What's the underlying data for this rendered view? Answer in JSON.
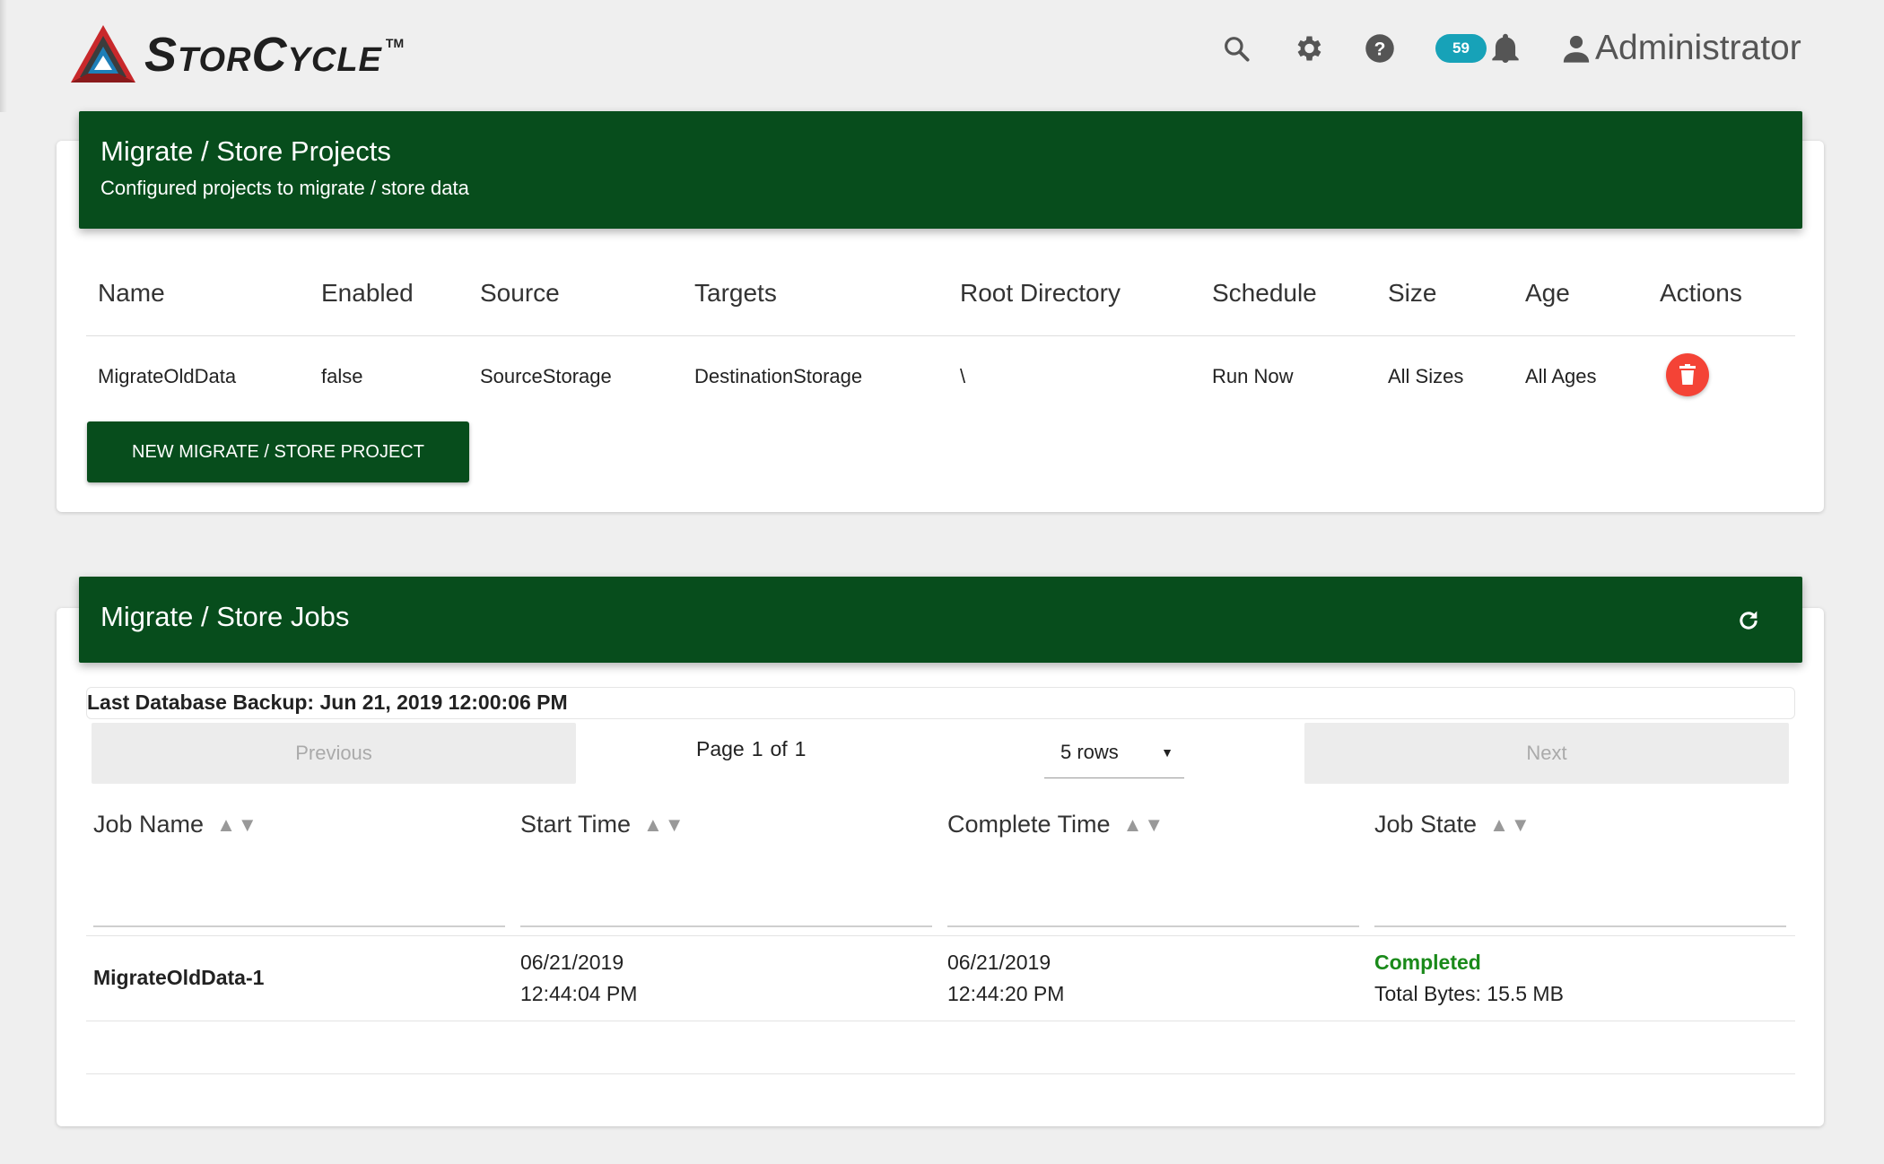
{
  "app": {
    "logo_text": "StorCycle",
    "logo_tm": "TM",
    "notification_count": "59",
    "user_name": "Administrator",
    "icons": [
      "search-icon",
      "gear-icon",
      "help-icon",
      "bell-icon",
      "user-icon"
    ]
  },
  "colors": {
    "header_green": "#074d1c",
    "delete_red": "#f44336",
    "badge_teal": "#17a2b8",
    "completed_green": "#1a8a1a"
  },
  "projects": {
    "title": "Migrate / Store Projects",
    "subtitle": "Configured projects to migrate / store data",
    "columns": [
      "Name",
      "Enabled",
      "Source",
      "Targets",
      "Root Directory",
      "Schedule",
      "Size",
      "Age",
      "Actions"
    ],
    "rows": [
      {
        "name": "MigrateOldData",
        "enabled": "false",
        "source": "SourceStorage",
        "targets": "DestinationStorage",
        "root_directory": "\\",
        "schedule": "Run Now",
        "size": "All Sizes",
        "age": "All Ages"
      }
    ],
    "new_button": "NEW MIGRATE / STORE PROJECT"
  },
  "jobs": {
    "title": "Migrate / Store Jobs",
    "last_backup": "Last Database Backup: Jun 21, 2019 12:00:06 PM",
    "pager": {
      "previous": "Previous",
      "next": "Next",
      "page_label": "Page",
      "page": "1",
      "of_label": "of",
      "total_pages": "1",
      "rows_selected": "5 rows"
    },
    "columns": [
      "Job Name",
      "Start Time",
      "Complete Time",
      "Job State"
    ],
    "rows": [
      {
        "job_name": "MigrateOldData-1",
        "start_date": "06/21/2019",
        "start_time": "12:44:04 PM",
        "complete_date": "06/21/2019",
        "complete_time": "12:44:20 PM",
        "state": "Completed",
        "total_bytes": "Total Bytes: 15.5 MB"
      }
    ]
  }
}
